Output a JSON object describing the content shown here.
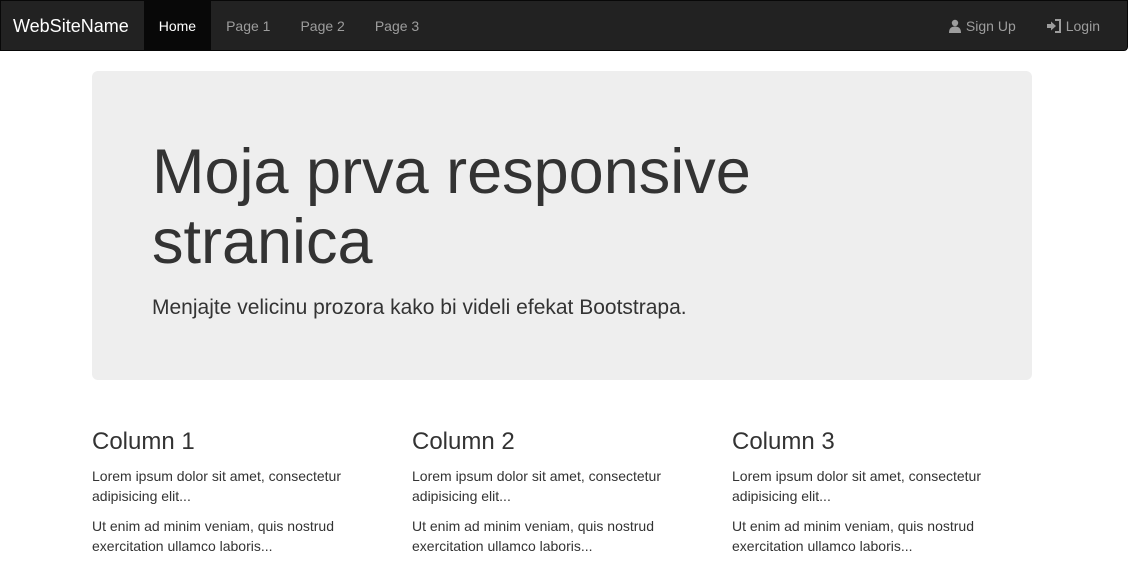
{
  "navbar": {
    "brand": "WebSiteName",
    "items": [
      {
        "label": "Home",
        "active": true
      },
      {
        "label": "Page 1",
        "active": false
      },
      {
        "label": "Page 2",
        "active": false
      },
      {
        "label": "Page 3",
        "active": false
      }
    ],
    "right": [
      {
        "label": "Sign Up",
        "icon": "user-icon"
      },
      {
        "label": "Login",
        "icon": "login-icon"
      }
    ]
  },
  "jumbotron": {
    "heading": "Moja prva responsive stranica",
    "lead": "Menjajte velicinu prozora kako bi videli efekat Bootstrapa."
  },
  "columns": [
    {
      "title": "Column 1",
      "p1": "Lorem ipsum dolor sit amet, consectetur adipisicing elit...",
      "p2": "Ut enim ad minim veniam, quis nostrud exercitation ullamco laboris..."
    },
    {
      "title": "Column 2",
      "p1": "Lorem ipsum dolor sit amet, consectetur adipisicing elit...",
      "p2": "Ut enim ad minim veniam, quis nostrud exercitation ullamco laboris..."
    },
    {
      "title": "Column 3",
      "p1": "Lorem ipsum dolor sit amet, consectetur adipisicing elit...",
      "p2": "Ut enim ad minim veniam, quis nostrud exercitation ullamco laboris..."
    }
  ],
  "colors": {
    "navbar_bg": "#222222",
    "nav_active_bg": "#080808",
    "nav_text": "#9d9d9d",
    "jumbotron_bg": "#eeeeee",
    "text": "#333333"
  }
}
